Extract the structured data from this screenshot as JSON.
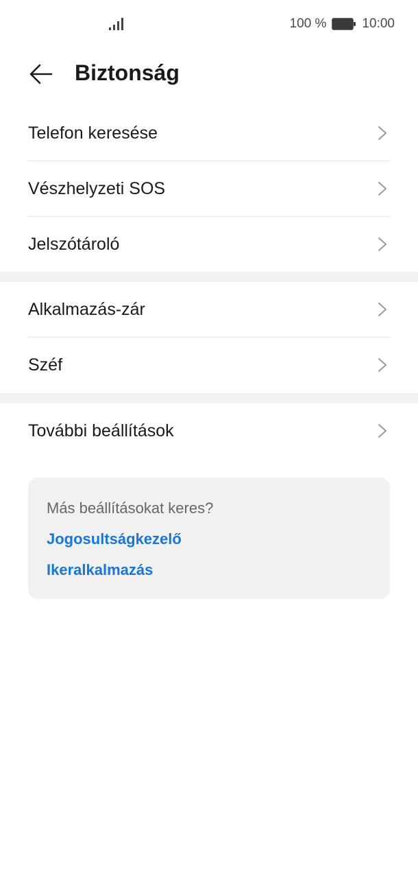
{
  "status_bar": {
    "battery_percent": "100 %",
    "time": "10:00",
    "signal_icon": "signal-bars-icon",
    "battery_icon": "battery-full-icon"
  },
  "header": {
    "back_icon": "back-arrow-icon",
    "title": "Biztonság"
  },
  "groups": [
    {
      "items": [
        {
          "label": "Telefon keresése"
        },
        {
          "label": "Vészhelyzeti SOS"
        },
        {
          "label": "Jelszótároló"
        }
      ]
    },
    {
      "items": [
        {
          "label": "Alkalmazás-zár"
        },
        {
          "label": "Széf"
        }
      ]
    },
    {
      "items": [
        {
          "label": "További beállítások"
        }
      ]
    }
  ],
  "suggestions": {
    "hint": "Más beállításokat keres?",
    "links": [
      {
        "label": "Jogosultságkezelő"
      },
      {
        "label": "Ikeralkalmazás"
      }
    ]
  },
  "colors": {
    "link": "#1877d6",
    "separator": "#f1f1f1",
    "divider": "#e2e2e2"
  }
}
